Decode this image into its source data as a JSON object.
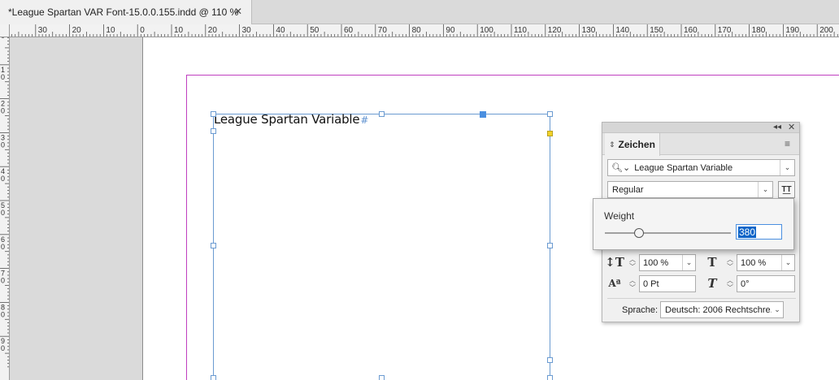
{
  "document_tab": {
    "title": "*League Spartan VAR Font-15.0.0.155.indd @ 110 %",
    "close_glyph": "✕"
  },
  "ruler": {
    "h_labels": [
      "0",
      "30",
      "20",
      "10",
      "0",
      "10",
      "20",
      "30",
      "40",
      "50",
      "60",
      "70",
      "80",
      "90",
      "100",
      "110",
      "120",
      "130",
      "140",
      "150",
      "160",
      "170",
      "180",
      "190",
      "200"
    ],
    "v_labels": [
      "0",
      "1 0",
      "2 0",
      "3 0",
      "4 0",
      "5 0",
      "6 0",
      "7 0",
      "8 0",
      "9 0"
    ]
  },
  "text_frame": {
    "text": "League Spartan Variable",
    "end_marker": "#"
  },
  "character_panel": {
    "tab_label": "Zeichen",
    "collapse_glyph": "◂◂",
    "close_glyph": "✕",
    "menu_glyph": "≡",
    "font_family": "League Spartan Variable",
    "font_style": "Regular",
    "font_size": "",
    "leading": "",
    "vertical_scale": "100 %",
    "horizontal_scale": "100 %",
    "baseline_shift": "0 Pt",
    "skew": "0°",
    "language_label": "Sprache:",
    "language_value": "Deutsch: 2006 Rechtschre..."
  },
  "weight_popup": {
    "label": "Weight",
    "value": "380",
    "slider_fraction": 0.27
  },
  "icons": {
    "search": "search-icon",
    "variable_font": "variable-font-settings-icon",
    "vertical_scale": "vertical-scale-icon",
    "horizontal_scale": "horizontal-scale-icon",
    "baseline_shift": "baseline-shift-icon",
    "skew": "skew-icon"
  },
  "colors": {
    "frame": "#6b9bd1",
    "margin_guide": "#c040c0",
    "selection": "#0a64c8"
  }
}
